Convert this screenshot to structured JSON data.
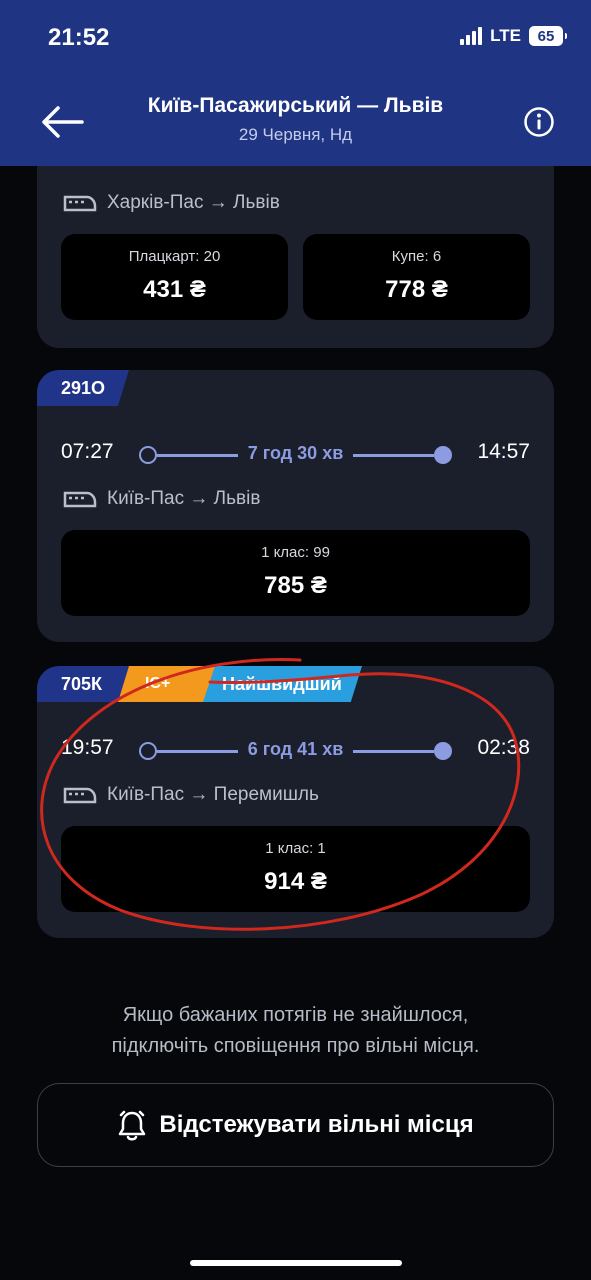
{
  "status_bar": {
    "time": "21:52",
    "network": "LTE",
    "battery": "65"
  },
  "header": {
    "title": "Київ-Пасажирський — Львів",
    "subtitle": "29 Червня, Нд"
  },
  "trains": [
    {
      "route": "Харків-Пас → Львів",
      "prices": [
        {
          "class": "Плацкарт: 20",
          "price": "431 ₴"
        },
        {
          "class": "Купе: 6",
          "price": "778 ₴"
        }
      ]
    },
    {
      "number": "291О",
      "departure": "07:27",
      "duration": "7 год 30 хв",
      "arrival": "14:57",
      "route": "Київ-Пас → Львів",
      "prices": [
        {
          "class": "1 клас: 99",
          "price": "785 ₴"
        }
      ]
    },
    {
      "number": "705К",
      "tag_type": "IC+",
      "tag_fastest": "Найшвидший",
      "departure": "19:57",
      "duration": "6 год 41 хв",
      "arrival": "02:38",
      "route": "Київ-Пас → Перемишль",
      "prices": [
        {
          "class": "1 клас: 1",
          "price": "914 ₴"
        }
      ]
    }
  ],
  "note": {
    "line1": "Якщо бажаних потягів не знайшлося,",
    "line2": "підключіть сповіщення про вільні місця."
  },
  "track_button": "Відстежувати вільні місця",
  "colors": {
    "header": "#1f3583",
    "card": "#1a1f2b",
    "accent": "#8d9be0",
    "badge_ic": "#f39a1e",
    "badge_fastest": "#2a9fe0",
    "annotation": "#d0281e"
  }
}
